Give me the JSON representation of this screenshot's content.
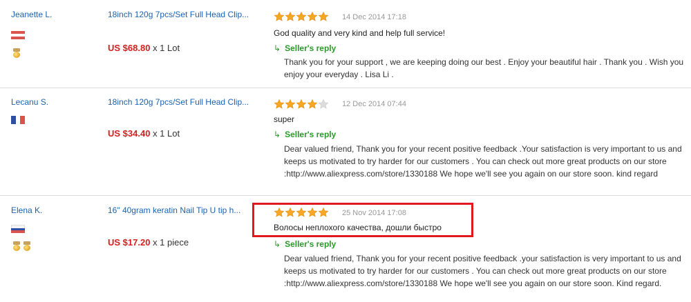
{
  "reviews": [
    {
      "buyer": "Jeanette L.",
      "product": "18inch 120g 7pcs/Set Full Head Clip...",
      "price": "US $68.80",
      "qty": "x 1 Lot",
      "rating": 5,
      "date": "14 Dec 2014 17:18",
      "feedback": "God quality and very kind and help full service!",
      "reply_label": "Seller's reply",
      "reply": "Thank you for your support , we are keeping doing our best . Enjoy your beautiful hair . Thank you . Wish you enjoy your everyday . Lisa Li ."
    },
    {
      "buyer": "Lecanu S.",
      "product": "18inch 120g 7pcs/Set Full Head Clip...",
      "price": "US $34.40",
      "qty": "x 1 Lot",
      "rating": 4,
      "date": "12 Dec 2014 07:44",
      "feedback": "super",
      "reply_label": "Seller's reply",
      "reply": "Dear valued friend, Thank you for your recent positive feedback .Your satisfaction is very important to us and keeps us motivated to try harder for our customers . You can check out more great products on our store :http://www.aliexpress.com/store/1330188 We hope we'll see you again on our store soon. kind regard"
    },
    {
      "buyer": "Elena K.",
      "product": "16\" 40gram keratin Nail Tip U tip h...",
      "price": "US $17.20",
      "qty": "x 1 piece",
      "rating": 5,
      "date": "25 Nov 2014 17:08",
      "feedback": "Волосы неплохого качества, дошли быстро",
      "reply_label": "Seller's reply",
      "reply": "Dear valued friend, Thank you for your recent positive feedback .your satisfaction is very important to us and keeps us motivated to try harder for our customers . You can check out more great products on our store :http://www.aliexpress.com/store/1330188 We hope we'll see you again on our store soon. Kind regard."
    }
  ],
  "icons": {
    "star": "star-icon",
    "reply_arrow": "↳",
    "medal": "medal-icon"
  },
  "colors": {
    "link": "#1a63b3",
    "price": "#d41f1f",
    "reply": "#2a9a2a",
    "star": "#f5a623",
    "highlight": "#e0191e"
  }
}
